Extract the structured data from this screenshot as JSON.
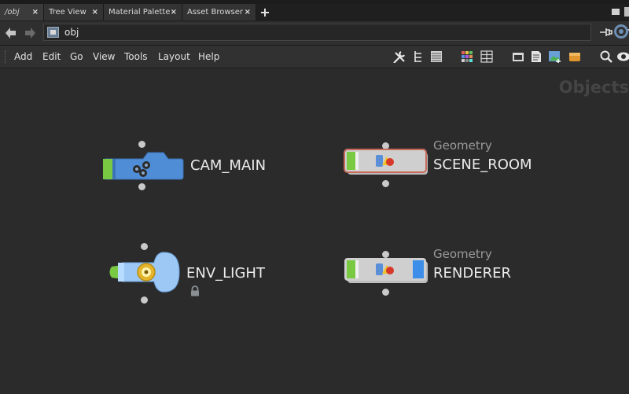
{
  "tabs": [
    {
      "label": "/obj",
      "close": "×"
    },
    {
      "label": "Tree View",
      "close": "×"
    },
    {
      "label": "Material Palette",
      "close": "×"
    },
    {
      "label": "Asset Browser",
      "close": "×"
    }
  ],
  "new_tab": "+",
  "path": {
    "value": "obj"
  },
  "menu": [
    "Add",
    "Edit",
    "Go",
    "View",
    "Tools",
    "Layout",
    "Help"
  ],
  "network": {
    "context": "Objects"
  },
  "nodes": {
    "cam_main": {
      "name": "CAM_MAIN"
    },
    "scene_room": {
      "type": "Geometry",
      "name": "SCENE_ROOM"
    },
    "env_light": {
      "name": "ENV_LIGHT"
    },
    "renderer": {
      "type": "Geometry",
      "name": "RENDERER"
    }
  },
  "colors": {
    "bg": "#2b2b2b",
    "node_green": "#7ac943",
    "node_blue": "#3d8ee8",
    "camera_blue": "#4f8ed6",
    "light_blue": "#9dc8f5",
    "geo_body": "#cfcfcf",
    "selected_outline": "#c86a5a"
  },
  "icons": [
    "back-arrow-icon",
    "forward-arrow-icon",
    "network-path-icon",
    "pin-icon",
    "target-icon",
    "wrench-icon",
    "tree-icon",
    "list-icon",
    "palette-icon",
    "grid-icon",
    "tab-icon",
    "note-icon",
    "image-icon",
    "box-icon",
    "search-icon",
    "eye-icon",
    "camera-icon",
    "lightbulb-icon",
    "lock-icon",
    "geometry-icon"
  ]
}
